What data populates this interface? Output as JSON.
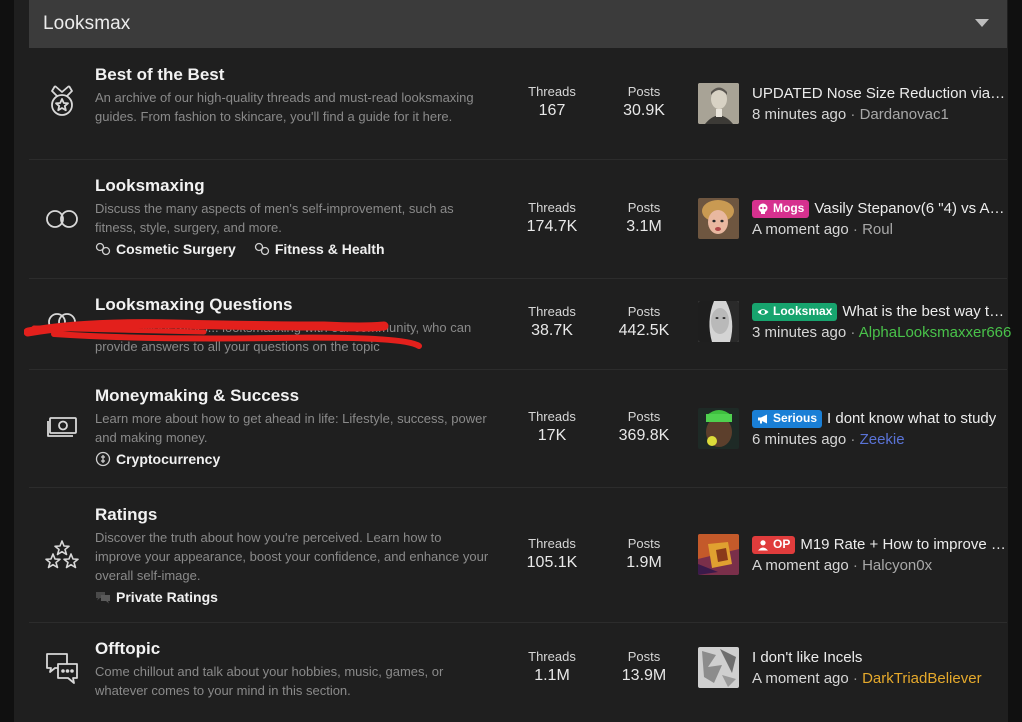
{
  "category": {
    "title": "Looksmax"
  },
  "nodes": [
    {
      "title": "Best of the Best",
      "desc": "An archive of our high-quality threads and must-read looksmaxing guides. From fashion to skincare, you'll find a guide for it here.",
      "icon": "medal-icon",
      "threads_label": "Threads",
      "threads": "167",
      "posts_label": "Posts",
      "posts": "30.9K",
      "latest": {
        "title": "UPDATED Nose Size Reduction via Sof...",
        "time": "8 minutes ago",
        "sep": "·",
        "user": "Dardanovac1"
      }
    },
    {
      "title": "Looksmaxing",
      "desc": "Discuss the many aspects of men's self-improvement, such as fitness, style, surgery, and more.",
      "icon": "infinity-icon",
      "subforums": [
        "Cosmetic Surgery",
        "Fitness & Health"
      ],
      "threads_label": "Threads",
      "threads": "174.7K",
      "posts_label": "Posts",
      "posts": "3.1M",
      "latest": {
        "badge": "Mogs",
        "badge_color": "#d6318f",
        "title": "Vasily Stepanov(6 \"4) vs Arc...",
        "time": "A moment ago",
        "sep": "·",
        "user": "Roul"
      }
    },
    {
      "title": "Looksmaxing Questions",
      "desc": "Ask the Moderators... looksmaxxing with our community, who can provide answers to all your questions on the topic",
      "icon": "chat-heart-icon",
      "threads_label": "Threads",
      "threads": "38.7K",
      "posts_label": "Posts",
      "posts": "442.5K",
      "latest": {
        "badge": "Looksmax",
        "badge_color": "#17a46e",
        "title": "What is the best way to ...",
        "time": "3 minutes ago",
        "sep": "·",
        "user": "AlphaLooksmaxxer666"
      }
    },
    {
      "title": "Moneymaking & Success",
      "desc": "Learn more about how to get ahead in life: Lifestyle, success, power and making money.",
      "icon": "money-icon",
      "subforums": [
        "Cryptocurrency"
      ],
      "threads_label": "Threads",
      "threads": "17K",
      "posts_label": "Posts",
      "posts": "369.8K",
      "latest": {
        "badge": "Serious",
        "badge_color": "#1a7fd6",
        "title": "I dont know what to study",
        "time": "6 minutes ago",
        "sep": "·",
        "user": "Zeekie"
      }
    },
    {
      "title": "Ratings",
      "desc": "Discover the truth about how you're perceived. Learn how to improve your appearance, boost your confidence, and enhance your overall self-image.",
      "icon": "stars-icon",
      "subforums": [
        "Private Ratings"
      ],
      "threads_label": "Threads",
      "threads": "105.1K",
      "posts_label": "Posts",
      "posts": "1.9M",
      "latest": {
        "badge": "OP",
        "badge_color": "#e03c3c",
        "title": "M19 Rate + How to improve a...",
        "time": "A moment ago",
        "sep": "·",
        "user": "Halcyon0x"
      }
    },
    {
      "title": "Offtopic",
      "desc": "Come chillout and talk about your hobbies, music, games, or whatever comes to your mind in this section.",
      "icon": "comments-icon",
      "threads_label": "Threads",
      "threads": "1.1M",
      "posts_label": "Posts",
      "posts": "13.9M",
      "latest": {
        "title": "I don't like Incels",
        "time": "A moment ago",
        "sep": "·",
        "user": "DarkTriadBeliever"
      }
    }
  ]
}
